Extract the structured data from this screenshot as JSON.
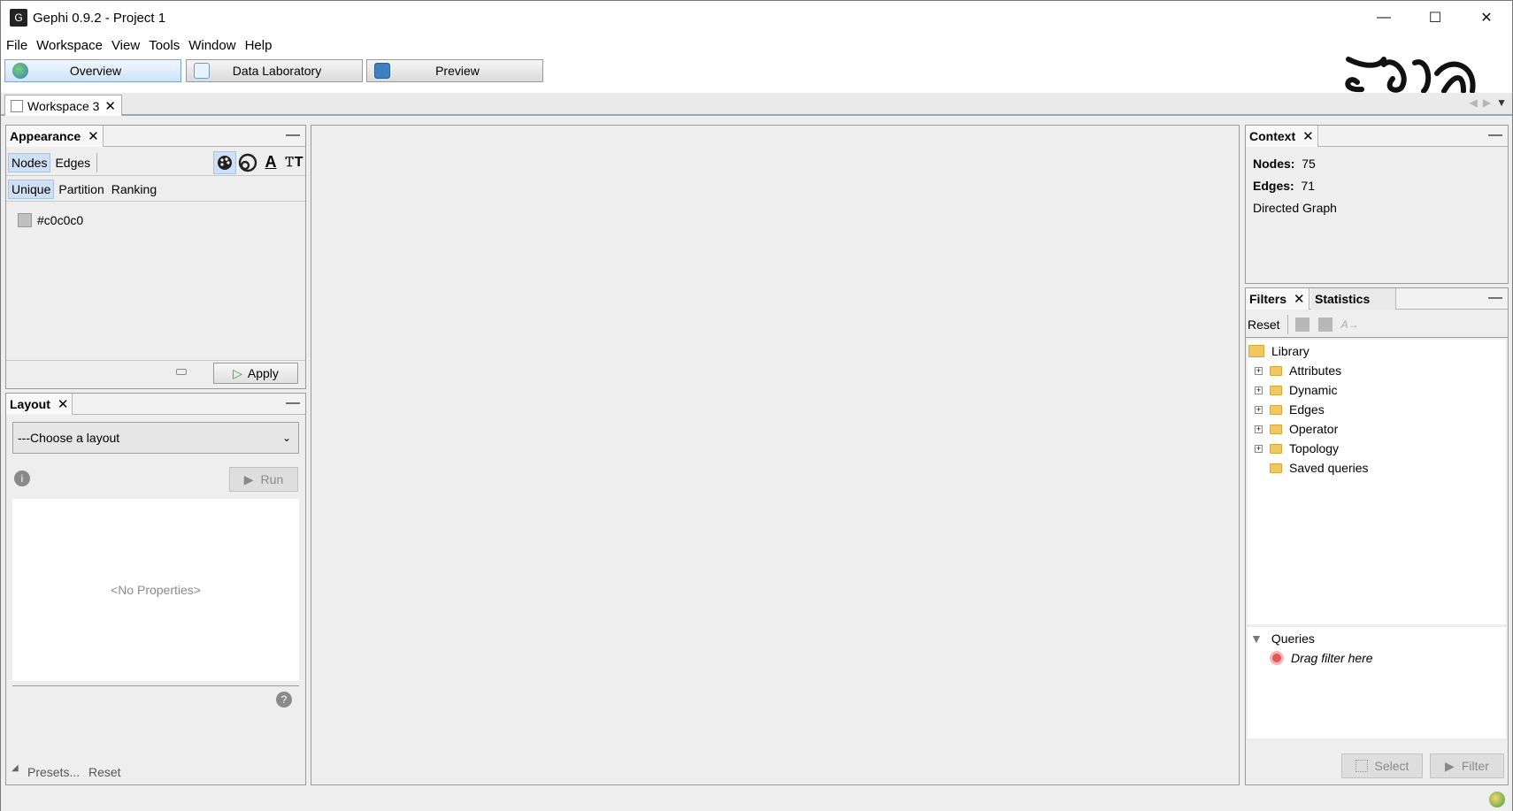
{
  "window": {
    "title": "Gephi 0.9.2 - Project 1"
  },
  "menu": [
    "File",
    "Workspace",
    "View",
    "Tools",
    "Window",
    "Help"
  ],
  "modes": {
    "overview": "Overview",
    "data_lab": "Data Laboratory",
    "preview": "Preview"
  },
  "workspace_tab": "Workspace 3",
  "appearance": {
    "title": "Appearance",
    "nodes": "Nodes",
    "edges": "Edges",
    "unique": "Unique",
    "partition": "Partition",
    "ranking": "Ranking",
    "color_value": "#c0c0c0",
    "apply": "Apply",
    "label_icon_text": "A"
  },
  "layout": {
    "title": "Layout",
    "choose": "---Choose a layout",
    "run": "Run",
    "no_properties": "<No Properties>",
    "presets": "Presets...",
    "reset": "Reset"
  },
  "context": {
    "title": "Context",
    "nodes_label": "Nodes:",
    "nodes_value": "75",
    "edges_label": "Edges:",
    "edges_value": "71",
    "graph_type": "Directed Graph"
  },
  "filters": {
    "title": "Filters",
    "statistics_tab": "Statistics",
    "reset": "Reset",
    "library": "Library",
    "items": [
      "Attributes",
      "Dynamic",
      "Edges",
      "Operator",
      "Topology"
    ],
    "saved": "Saved queries",
    "queries": "Queries",
    "drag_hint": "Drag filter here",
    "select": "Select",
    "filter": "Filter"
  }
}
